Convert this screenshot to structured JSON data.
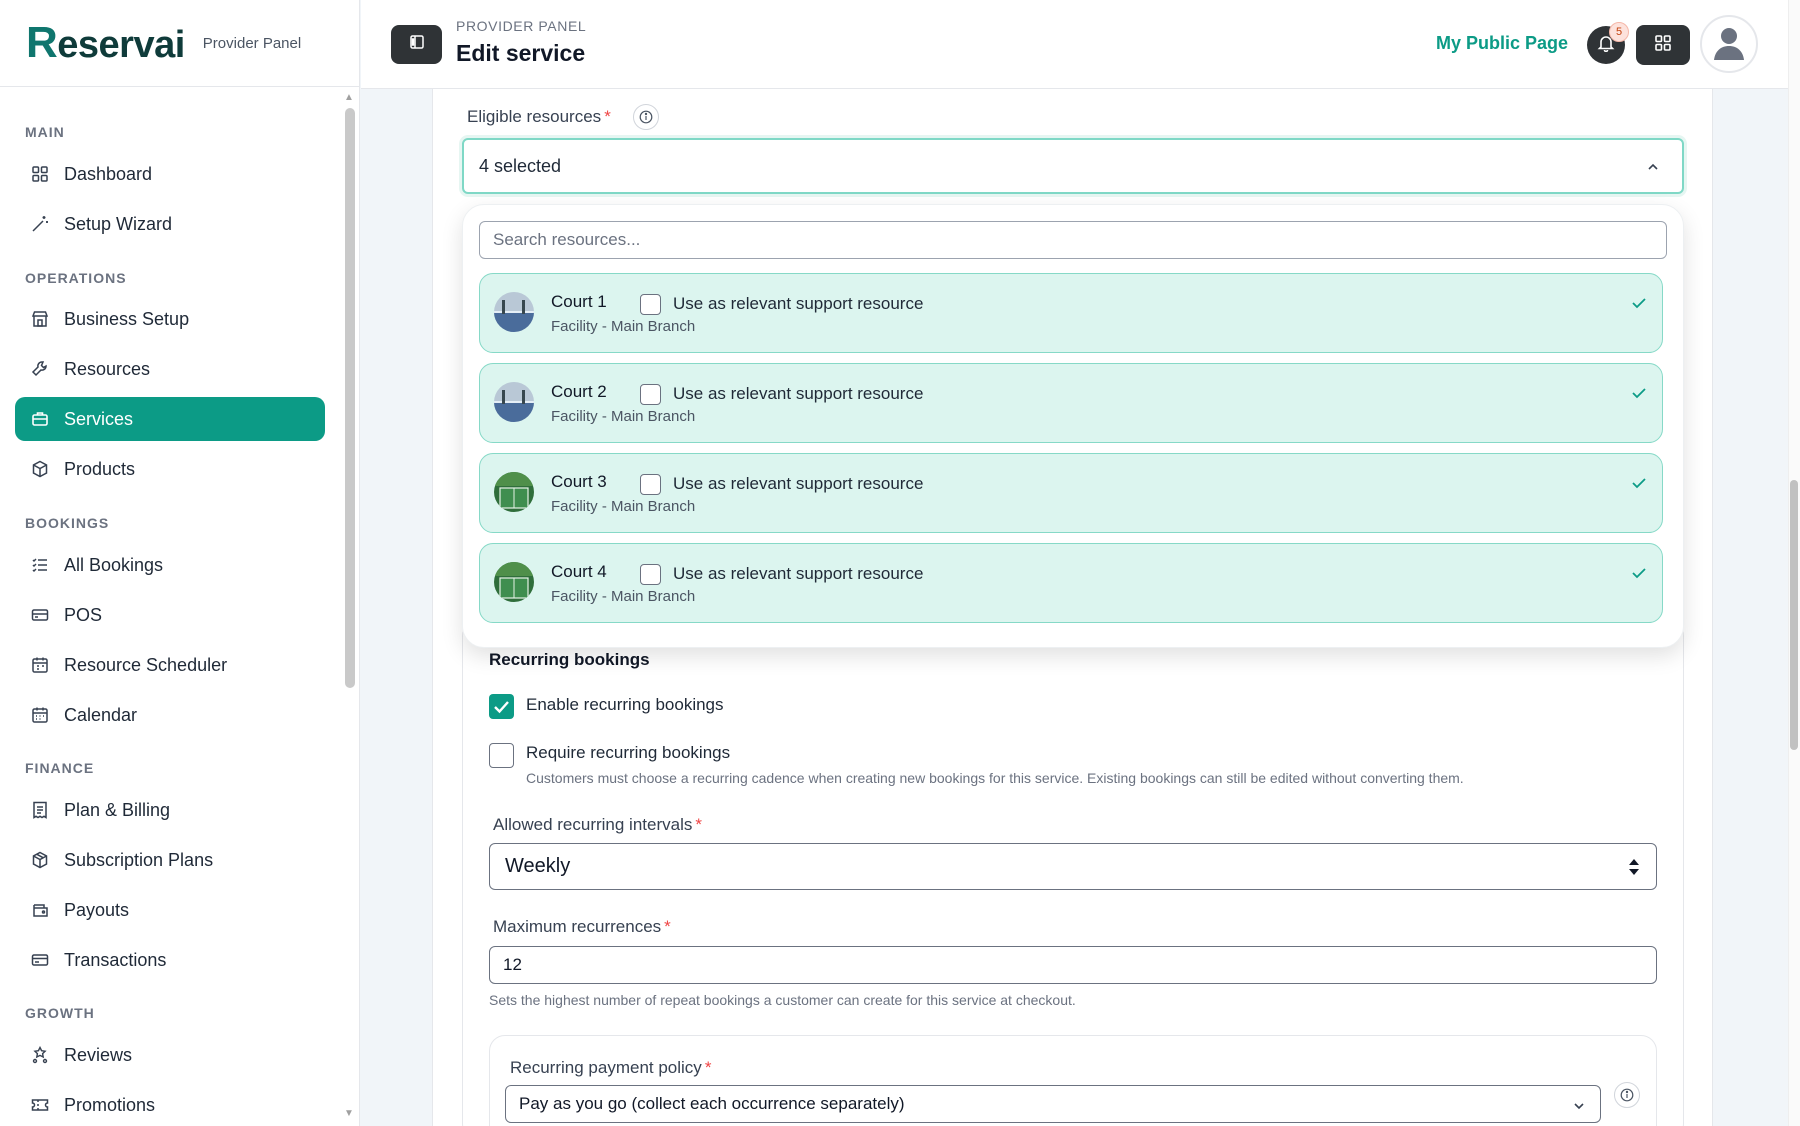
{
  "sidebar": {
    "logo_first": "R",
    "logo_rest": "eservai",
    "brand_sub": "Provider Panel",
    "sections": {
      "main": "MAIN",
      "operations": "OPERATIONS",
      "bookings": "BOOKINGS",
      "finance": "FINANCE",
      "growth": "GROWTH"
    },
    "items": {
      "dashboard": "Dashboard",
      "setup_wizard": "Setup Wizard",
      "business_setup": "Business Setup",
      "resources": "Resources",
      "services": "Services",
      "products": "Products",
      "all_bookings": "All Bookings",
      "pos": "POS",
      "resource_scheduler": "Resource Scheduler",
      "calendar": "Calendar",
      "plan_billing": "Plan & Billing",
      "subscription_plans": "Subscription Plans",
      "payouts": "Payouts",
      "transactions": "Transactions",
      "reviews": "Reviews",
      "promotions": "Promotions"
    },
    "active_item": "services"
  },
  "header": {
    "eyebrow": "PROVIDER PANEL",
    "title": "Edit service",
    "public_link": "My Public Page",
    "notification_count": "5"
  },
  "eligible": {
    "label": "Eligible resources",
    "required_mark": "*",
    "selected_text": "4 selected",
    "search_placeholder": "Search resources...",
    "support_label": "Use as relevant support resource",
    "resources": [
      {
        "name": "Court 1",
        "sub": "Facility - Main Branch",
        "checked": true,
        "support": false
      },
      {
        "name": "Court 2",
        "sub": "Facility - Main Branch",
        "checked": true,
        "support": false
      },
      {
        "name": "Court 3",
        "sub": "Facility - Main Branch",
        "checked": true,
        "support": false
      },
      {
        "name": "Court 4",
        "sub": "Facility - Main Branch",
        "checked": true,
        "support": false
      }
    ]
  },
  "recurring": {
    "title": "Recurring bookings",
    "enable_label": "Enable recurring bookings",
    "enable_checked": true,
    "require_label": "Require recurring bookings",
    "require_checked": false,
    "require_hint": "Customers must choose a recurring cadence when creating new bookings for this service. Existing bookings can still be edited without converting them.",
    "intervals_label": "Allowed recurring intervals",
    "intervals_value": "Weekly",
    "max_label": "Maximum recurrences",
    "max_value": "12",
    "max_hint": "Sets the highest number of repeat bookings a customer can create for this service at checkout.",
    "payment_label": "Recurring payment policy",
    "payment_value": "Pay as you go (collect each occurrence separately)"
  },
  "colors": {
    "accent": "#0c9b86",
    "selected_row_bg": "#dcf5ef",
    "dark_button": "#2f3336"
  }
}
